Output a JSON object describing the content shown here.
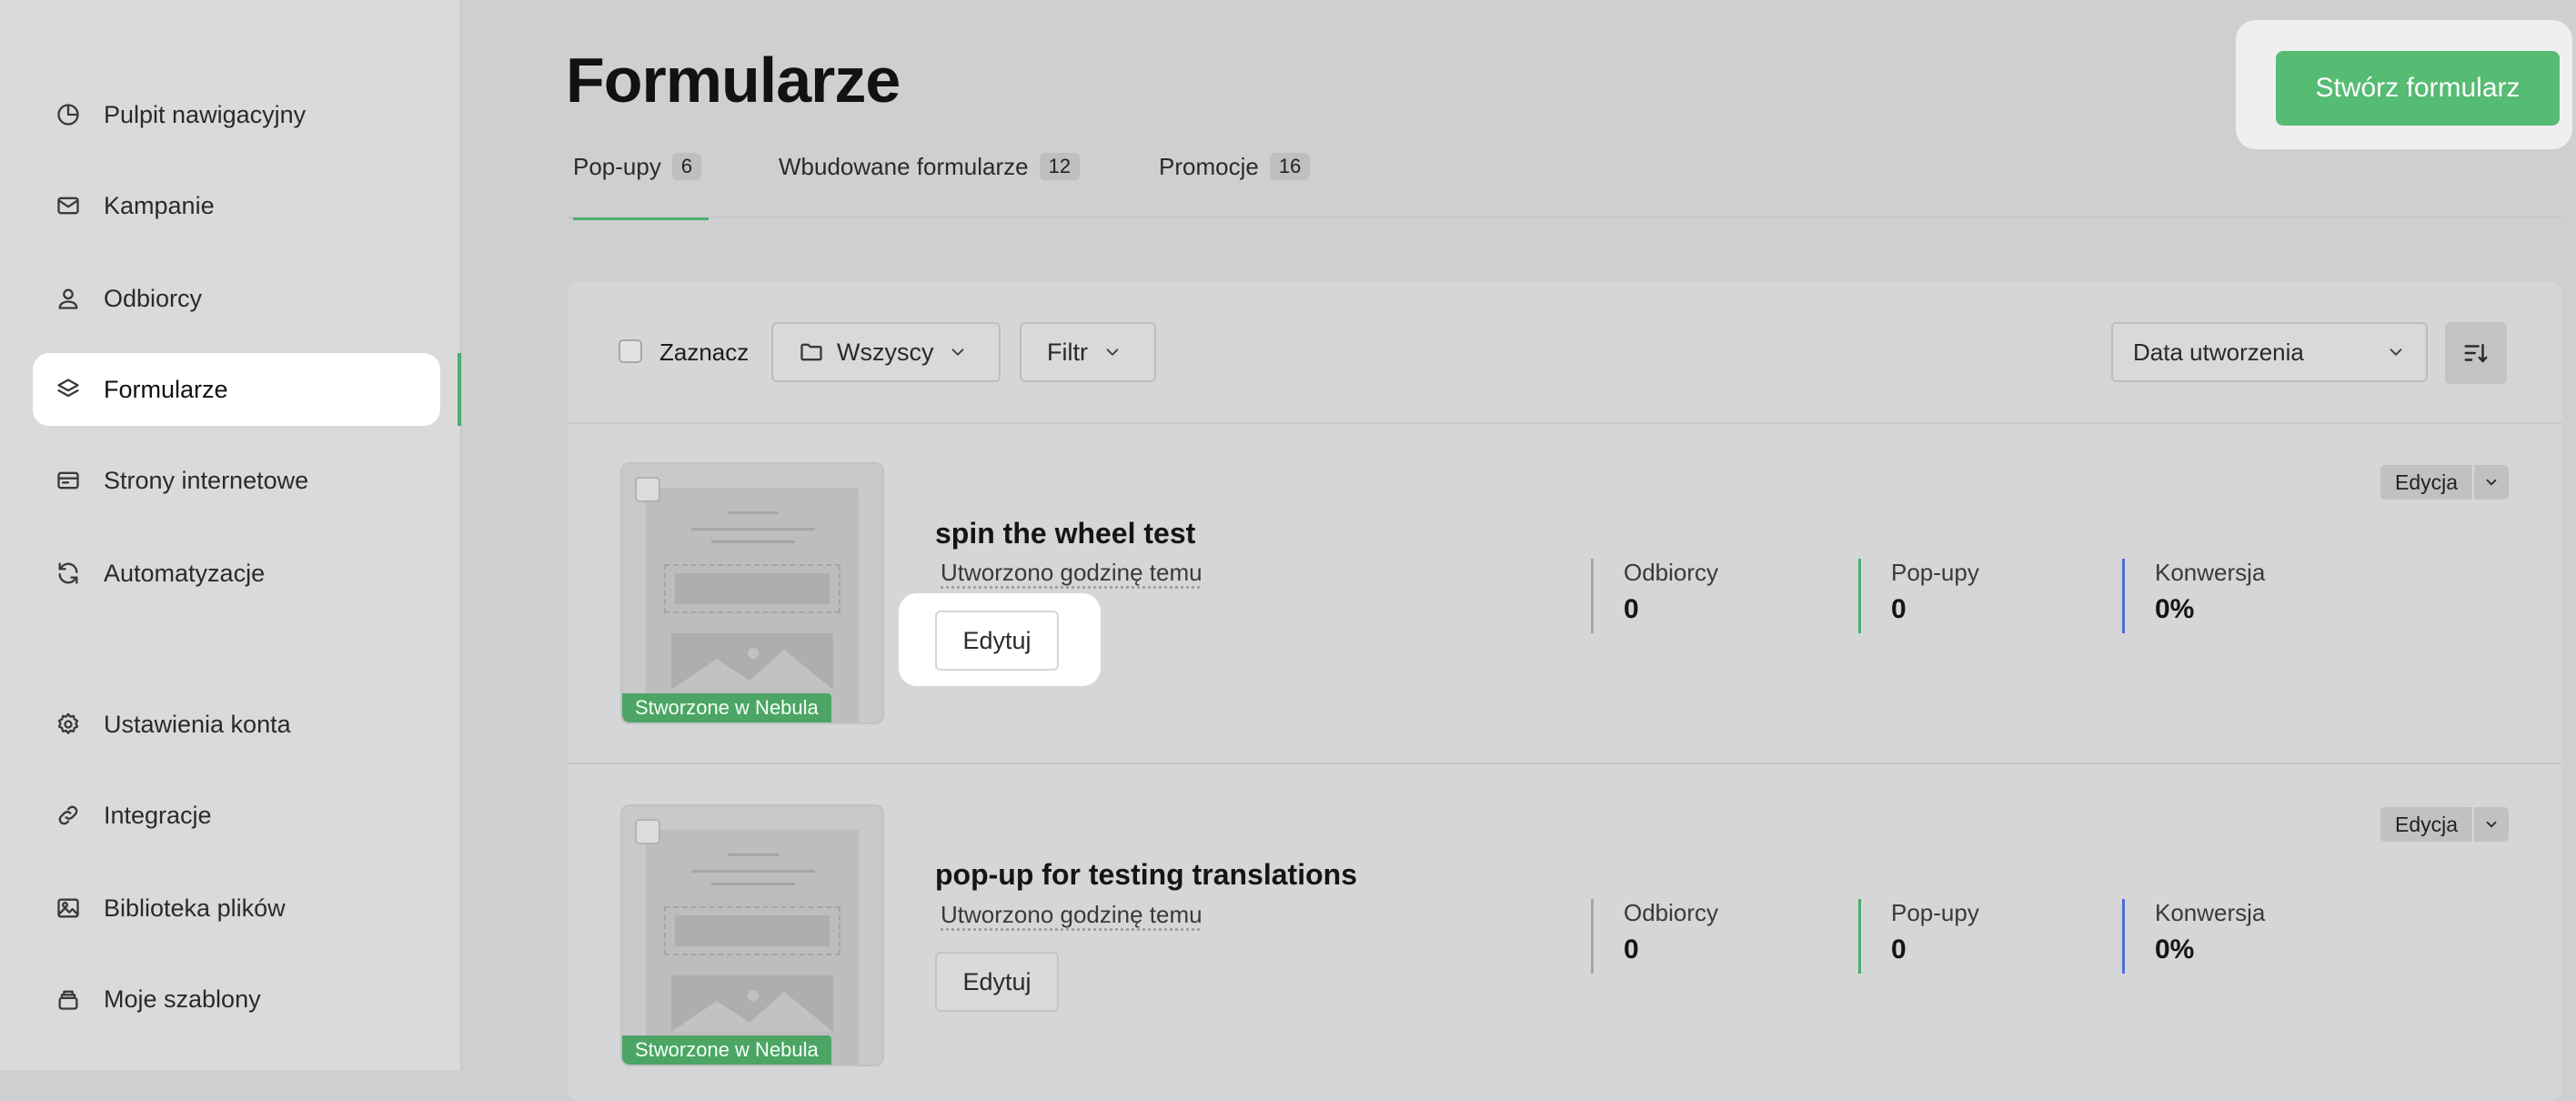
{
  "sidebar": {
    "items": [
      {
        "label": "Pulpit nawigacyjny",
        "icon": "chart-pie-icon"
      },
      {
        "label": "Kampanie",
        "icon": "mail-icon"
      },
      {
        "label": "Odbiorcy",
        "icon": "user-icon"
      },
      {
        "label": "Formularze",
        "icon": "layers-icon",
        "active": true
      },
      {
        "label": "Strony internetowe",
        "icon": "browser-icon"
      },
      {
        "label": "Automatyzacje",
        "icon": "refresh-icon"
      },
      {
        "label": "Ustawienia konta",
        "icon": "gear-icon"
      },
      {
        "label": "Integracje",
        "icon": "link-icon"
      },
      {
        "label": "Biblioteka plików",
        "icon": "image-icon"
      },
      {
        "label": "Moje szablony",
        "icon": "stack-icon"
      }
    ]
  },
  "header": {
    "title": "Formularze",
    "create_button": "Stwórz formularz"
  },
  "tabs": [
    {
      "label": "Pop-upy",
      "count": "6",
      "active": true
    },
    {
      "label": "Wbudowane formularze",
      "count": "12"
    },
    {
      "label": "Promocje",
      "count": "16"
    }
  ],
  "toolbar": {
    "select_label": "Zaznacz",
    "folder_label": "Wszyscy",
    "filter_label": "Filtr",
    "sort_label": "Data utworzenia"
  },
  "forms": [
    {
      "name": "spin the wheel test",
      "created": "Utworzono godzinę temu",
      "edit_label": "Edytuj",
      "badge": "Stworzone w Nebula",
      "action_label": "Edycja",
      "stats": [
        {
          "label": "Odbiorcy",
          "value": "0"
        },
        {
          "label": "Pop-upy",
          "value": "0"
        },
        {
          "label": "Konwersja",
          "value": "0%"
        }
      ]
    },
    {
      "name": "pop-up for testing translations",
      "created": "Utworzono godzinę temu",
      "edit_label": "Edytuj",
      "badge": "Stworzone w Nebula",
      "action_label": "Edycja",
      "stats": [
        {
          "label": "Odbiorcy",
          "value": "0"
        },
        {
          "label": "Pop-upy",
          "value": "0"
        },
        {
          "label": "Konwersja",
          "value": "0%"
        }
      ]
    }
  ],
  "colors": {
    "accent_green": "#56bb73",
    "stat_green": "#4cae6b",
    "stat_blue": "#4a6fd4"
  }
}
